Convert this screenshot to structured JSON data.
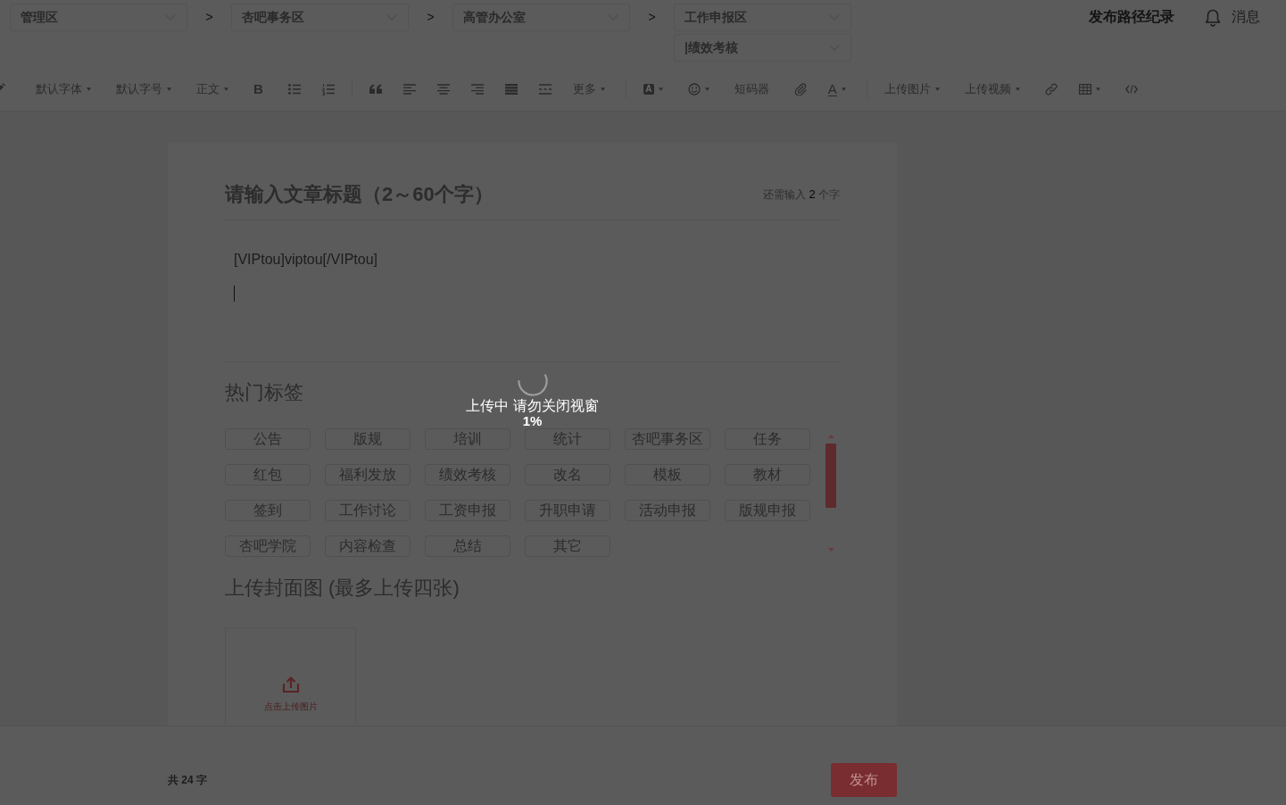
{
  "path_selects": [
    {
      "value": "管理区"
    },
    {
      "separator": ">",
      "value": "杏吧事务区"
    },
    {
      "separator": ">",
      "value": "高管办公室"
    },
    {
      "separator": ">",
      "value": "工作申报区",
      "sub_value": "|绩效考核"
    }
  ],
  "header": {
    "publish_log": "发布路径纪录",
    "messages": "消息"
  },
  "toolbar": [
    {
      "kind": "pencil"
    },
    {
      "kind": "font",
      "label": "默认字体"
    },
    {
      "kind": "size",
      "label": "默认字号"
    },
    {
      "kind": "format",
      "label": "正文"
    },
    {
      "kind": "bold",
      "label": "B"
    },
    {
      "kind": "bullets"
    },
    {
      "kind": "numbers"
    },
    {
      "kind": "separator"
    },
    {
      "kind": "quote"
    },
    {
      "kind": "left"
    },
    {
      "kind": "center"
    },
    {
      "kind": "right"
    },
    {
      "kind": "justify"
    },
    {
      "kind": "rule"
    },
    {
      "kind": "more",
      "label": "更多"
    },
    {
      "kind": "separator"
    },
    {
      "kind": "highlight",
      "label": "A"
    },
    {
      "kind": "emoji"
    },
    {
      "kind": "shortcode",
      "label": "短码器"
    },
    {
      "kind": "attach"
    },
    {
      "kind": "color",
      "label": "A"
    },
    {
      "kind": "separator"
    },
    {
      "kind": "image",
      "label": "上传图片"
    },
    {
      "kind": "video",
      "label": "上传视频"
    },
    {
      "kind": "link"
    },
    {
      "kind": "table"
    },
    {
      "kind": "code"
    }
  ],
  "title": {
    "placeholder": "请输入文章标题（2～60个字）",
    "counter": "还需输入 **2** 个字"
  },
  "editor": {
    "paragraphs": [
      "[VIPtou]viptou[/VIPtou]"
    ],
    "cursor": true
  },
  "hot_tags": {
    "title": "热门标签",
    "tags": [
      {
        "label": "公告",
        "selected": false
      },
      {
        "label": "版规",
        "selected": false
      },
      {
        "label": "培训",
        "selected": false
      },
      {
        "label": "统计",
        "selected": false
      },
      {
        "label": "杏吧事务区",
        "selected": false
      },
      {
        "label": "任务",
        "selected": false
      },
      {
        "label": "红包",
        "selected": false
      },
      {
        "label": "福利发放",
        "selected": false
      },
      {
        "label": "绩效考核",
        "selected": false
      },
      {
        "label": "改名",
        "selected": false
      },
      {
        "label": "模板",
        "selected": false
      },
      {
        "label": "教材",
        "selected": false
      },
      {
        "label": "签到",
        "selected": false
      },
      {
        "label": "工作讨论",
        "selected": false
      },
      {
        "label": "工资申报",
        "selected": false
      },
      {
        "label": "升职申请",
        "selected": false
      },
      {
        "label": "活动申报",
        "selected": false
      },
      {
        "label": "版规申报",
        "selected": false
      },
      {
        "label": "杏吧学院",
        "selected": false
      },
      {
        "label": "内容检查",
        "selected": false
      },
      {
        "label": "总结",
        "selected": false
      },
      {
        "label": "其它",
        "selected": false
      }
    ]
  },
  "cover_upload": {
    "title": "上传封面图 (最多上传四张)",
    "button": "点击上传图片"
  },
  "footer": {
    "word_count": "共 24 字",
    "publish": "发布"
  },
  "upload_status": {
    "message": "上传中 请勿关闭视窗",
    "progress": "1%"
  }
}
